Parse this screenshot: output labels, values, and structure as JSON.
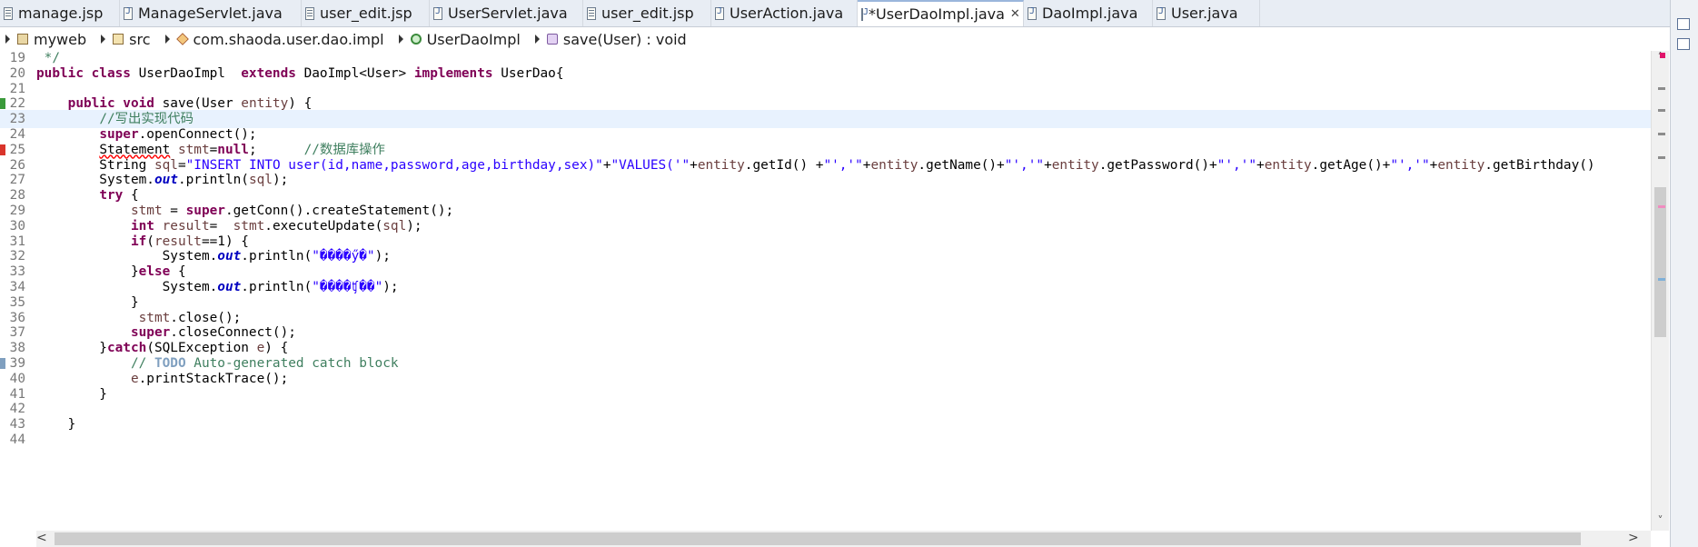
{
  "tabs": [
    {
      "label": "manage.jsp",
      "type": "jsp",
      "width": 132
    },
    {
      "label": "ManageServlet.java",
      "type": "java",
      "width": 200
    },
    {
      "label": "user_edit.jsp",
      "type": "jsp",
      "width": 141
    },
    {
      "label": "UserServlet.java",
      "type": "java",
      "width": 169
    },
    {
      "label": "user_edit.jsp",
      "type": "jsp",
      "width": 141
    },
    {
      "label": "UserAction.java",
      "type": "java",
      "width": 161
    },
    {
      "label": "*UserDaoImpl.java",
      "type": "java",
      "width": 183,
      "active": true,
      "close": "✕"
    },
    {
      "label": "DaoImpl.java",
      "type": "java",
      "width": 142
    },
    {
      "label": "User.java",
      "type": "java",
      "width": 118
    }
  ],
  "breadcrumb": [
    {
      "label": "myweb",
      "icon": "project-icon"
    },
    {
      "label": "src",
      "icon": "source-folder-icon"
    },
    {
      "label": "com.shaoda.user.dao.impl",
      "icon": "package-icon"
    },
    {
      "label": "UserDaoImpl",
      "icon": "class-icon"
    },
    {
      "label": "save(User) : void",
      "icon": "method-icon"
    }
  ],
  "editor": {
    "current_line": 23,
    "lines": [
      {
        "n": "19",
        "html": " <span class=\"com\">*/</span>"
      },
      {
        "n": "20",
        "html": "<span class=\"kw\">public class</span> UserDaoImpl  <span class=\"kw\">extends</span> DaoImpl&lt;User&gt; <span class=\"kw\">implements</span> UserDao{"
      },
      {
        "n": "21",
        "html": ""
      },
      {
        "n": "22",
        "html": "    <span class=\"kw\">public void</span> save(User <span class=\"var\">entity</span>) {",
        "marker": "override"
      },
      {
        "n": "23",
        "html": "        <span class=\"com\">//写出实现代码</span>"
      },
      {
        "n": "24",
        "html": "        <span class=\"kw\">super</span>.openConnect();"
      },
      {
        "n": "25",
        "html": "        <span class=\"err\">Statement</span> <span class=\"var\">stmt</span>=<span class=\"kw\">null</span>;      <span class=\"com\">//数据库操作</span>",
        "marker": "error"
      },
      {
        "n": "26",
        "html": "        String <span class=\"var\">sql</span>=<span class=\"str\">\"INSERT INTO user(id,name,password,age,birthday,sex)\"</span>+<span class=\"str\">\"VALUES('\"</span>+<span class=\"var\">entity</span>.getId() +<span class=\"str\">\"','\"</span>+<span class=\"var\">entity</span>.getName()+<span class=\"str\">\"','\"</span>+<span class=\"var\">entity</span>.getPassword()+<span class=\"str\">\"','\"</span>+<span class=\"var\">entity</span>.getAge()+<span class=\"str\">\"','\"</span>+<span class=\"var\">entity</span>.getBirthday()"
      },
      {
        "n": "27",
        "html": "        System.<span class=\"fld\">out</span>.println(<span class=\"var\">sql</span>);"
      },
      {
        "n": "28",
        "html": "        <span class=\"kw\">try</span> {"
      },
      {
        "n": "29",
        "html": "            <span class=\"var\">stmt</span> = <span class=\"kw\">super</span>.getConn().createStatement();"
      },
      {
        "n": "30",
        "html": "            <span class=\"kw\">int</span> <span class=\"var\">result</span>=  <span class=\"var\">stmt</span>.executeUpdate(<span class=\"var\">sql</span>);"
      },
      {
        "n": "31",
        "html": "            <span class=\"kw\">if</span>(<span class=\"var\">result</span>==1) {"
      },
      {
        "n": "32",
        "html": "                System.<span class=\"fld\">out</span>.println(<span class=\"str\">\"����ӳ�\"</span>);"
      },
      {
        "n": "33",
        "html": "            }<span class=\"kw\">else</span> {"
      },
      {
        "n": "34",
        "html": "                System.<span class=\"fld\">out</span>.println(<span class=\"str\">\"����ʧ��\"</span>);"
      },
      {
        "n": "35",
        "html": "            }"
      },
      {
        "n": "36",
        "html": "             <span class=\"var\">stmt</span>.close();"
      },
      {
        "n": "37",
        "html": "            <span class=\"kw\">super</span>.closeConnect();"
      },
      {
        "n": "38",
        "html": "        }<span class=\"kw\">catch</span>(SQLException <span class=\"var\">e</span>) {"
      },
      {
        "n": "39",
        "html": "            <span class=\"com\">// <span class=\"todo\">TODO</span> Auto-generated catch block</span>",
        "marker": "task"
      },
      {
        "n": "40",
        "html": "            <span class=\"var\">e</span>.printStackTrace();"
      },
      {
        "n": "41",
        "html": "        }"
      },
      {
        "n": "42",
        "html": ""
      },
      {
        "n": "43",
        "html": "    }"
      },
      {
        "n": "44",
        "html": ""
      }
    ]
  },
  "colors": {
    "keyword": "#7f0055",
    "string": "#2a00ff",
    "comment": "#3f7f5f",
    "current_line": "#e8f2fe"
  }
}
